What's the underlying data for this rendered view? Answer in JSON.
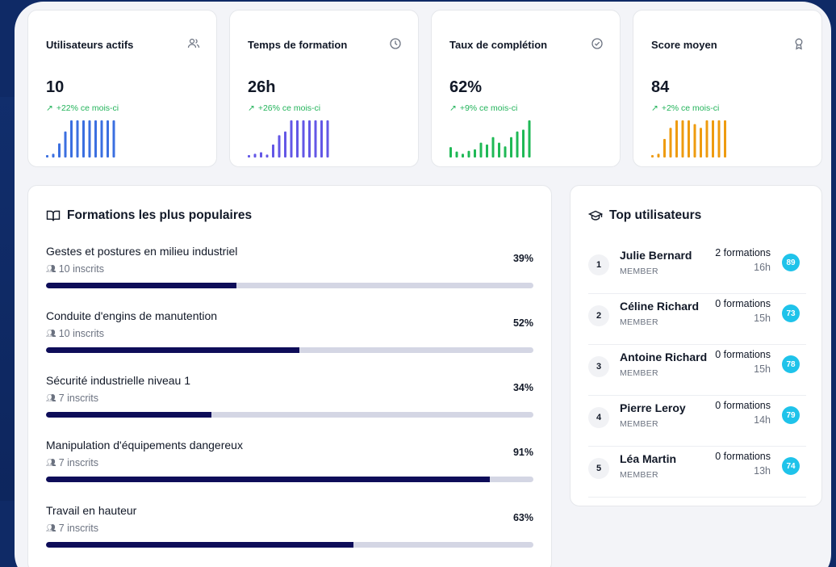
{
  "stats": [
    {
      "title": "Utilisateurs actifs",
      "icon": "users-icon",
      "value": "10",
      "trend": "+22% ce mois-ci",
      "color": "#3b6fe0",
      "spark": [
        0.06,
        0.1,
        0.38,
        0.7,
        1.0,
        1.0,
        1.0,
        1.0,
        1.0,
        1.0,
        1.0,
        1.0
      ]
    },
    {
      "title": "Temps de formation",
      "icon": "clock-icon",
      "value": "26h",
      "trend": "+26% ce mois-ci",
      "color": "#6357e6",
      "spark": [
        0.06,
        0.1,
        0.14,
        0.08,
        0.35,
        0.6,
        0.7,
        1.0,
        1.0,
        1.0,
        1.0,
        1.0,
        1.0,
        1.0
      ]
    },
    {
      "title": "Taux de complétion",
      "icon": "check-circle-icon",
      "value": "62%",
      "trend": "+9% ce mois-ci",
      "color": "#1fb956",
      "spark": [
        0.28,
        0.16,
        0.1,
        0.18,
        0.22,
        0.4,
        0.35,
        0.55,
        0.4,
        0.3,
        0.55,
        0.7,
        0.75,
        1.0
      ]
    },
    {
      "title": "Score moyen",
      "icon": "award-icon",
      "value": "84",
      "trend": "+2% ce mois-ci",
      "color": "#ee9b0f",
      "spark": [
        0.06,
        0.1,
        0.5,
        0.8,
        1.0,
        1.0,
        1.0,
        0.9,
        0.8,
        1.0,
        1.0,
        1.0,
        1.0
      ]
    }
  ],
  "popular": {
    "title": "Formations les plus populaires",
    "courses": [
      {
        "name": "Gestes et postures en milieu industriel",
        "enrolled": "10 inscrits",
        "pct_label": "39%",
        "progress": 0.39
      },
      {
        "name": "Conduite d'engins de manutention",
        "enrolled": "10 inscrits",
        "pct_label": "52%",
        "progress": 0.52
      },
      {
        "name": "Sécurité industrielle niveau 1",
        "enrolled": "7 inscrits",
        "pct_label": "34%",
        "progress": 0.34
      },
      {
        "name": "Manipulation d'équipements dangereux",
        "enrolled": "7 inscrits",
        "pct_label": "91%",
        "progress": 0.91
      },
      {
        "name": "Travail en hauteur",
        "enrolled": "7 inscrits",
        "pct_label": "63%",
        "progress": 0.63
      }
    ]
  },
  "top_users": {
    "title": "Top utilisateurs",
    "users": [
      {
        "rank": "1",
        "name": "Julie Bernard",
        "role": "MEMBER",
        "formations": "2 formations",
        "hours": "16h",
        "score": "89"
      },
      {
        "rank": "2",
        "name": "Céline Richard",
        "role": "MEMBER",
        "formations": "0 formations",
        "hours": "15h",
        "score": "73"
      },
      {
        "rank": "3",
        "name": "Antoine Richard",
        "role": "MEMBER",
        "formations": "0 formations",
        "hours": "15h",
        "score": "78"
      },
      {
        "rank": "4",
        "name": "Pierre Leroy",
        "role": "MEMBER",
        "formations": "0 formations",
        "hours": "14h",
        "score": "79"
      },
      {
        "rank": "5",
        "name": "Léa Martin",
        "role": "MEMBER",
        "formations": "0 formations",
        "hours": "13h",
        "score": "74"
      }
    ]
  }
}
